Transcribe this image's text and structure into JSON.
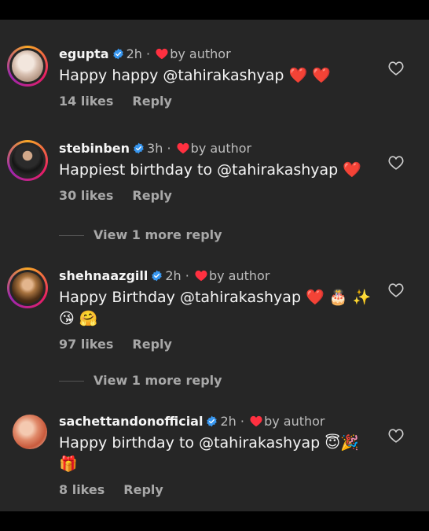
{
  "colors": {
    "background": "#262626",
    "heart": "#ff3040",
    "verified": "#3897f0",
    "muted": "#a8a8a8"
  },
  "comments": [
    {
      "username": "egupta",
      "time": "2h",
      "author_like": "by author",
      "text": "Happy happy @tahirakashyap",
      "emojis": [
        "❤️",
        "❤️"
      ],
      "likes": "14 likes",
      "reply": "Reply"
    },
    {
      "username": "stebinben",
      "time": "3h",
      "author_like": "by author",
      "text": "Happiest birthday to @tahirakashyap",
      "emojis": [
        "❤️"
      ],
      "likes": "30 likes",
      "reply": "Reply"
    },
    {
      "username": "shehnaazgill",
      "time": "2h",
      "author_like": "by author",
      "text": "Happy Birthday @tahirakashyap",
      "emojis": [
        "❤️",
        "🎂",
        "✨",
        "😘",
        "🤗"
      ],
      "likes": "97 likes",
      "reply": "Reply"
    },
    {
      "username": "sachettandonofficial",
      "time": "2h",
      "author_like": "by author",
      "text": "Happy birthday to @tahirakashyap",
      "emojis": [
        "😇",
        "🎉",
        "🎁"
      ],
      "likes": "8 likes",
      "reply": "Reply"
    }
  ],
  "view_more": [
    "View 1 more reply",
    "View 1 more reply"
  ],
  "separator": "·"
}
